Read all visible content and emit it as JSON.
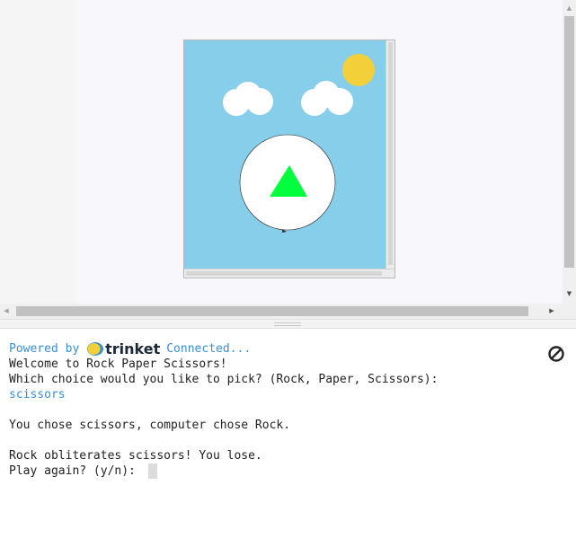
{
  "graphics": {
    "canvas_icons": [
      "cloud-icon",
      "cloud-icon",
      "sun-icon",
      "triangle-icon"
    ],
    "colors": {
      "sky": "#87ceea",
      "sun": "#f3d03a",
      "cloud": "#ffffff",
      "choice_circle": "#ffffff",
      "triangle": "#00ff3c"
    }
  },
  "console": {
    "powered_by": "Powered by",
    "brand": "trinket",
    "status": "Connected...",
    "lines": [
      "Welcome to Rock Paper Scissors!",
      "Which choice would you like to pick? (Rock, Paper, Scissors):"
    ],
    "user_input": "scissors",
    "result_line": "You chose scissors, computer chose Rock.",
    "outcome_line": "Rock obliterates scissors! You lose.",
    "prompt": "Play again? (y/n): ",
    "stop_icon": "stop-icon"
  }
}
